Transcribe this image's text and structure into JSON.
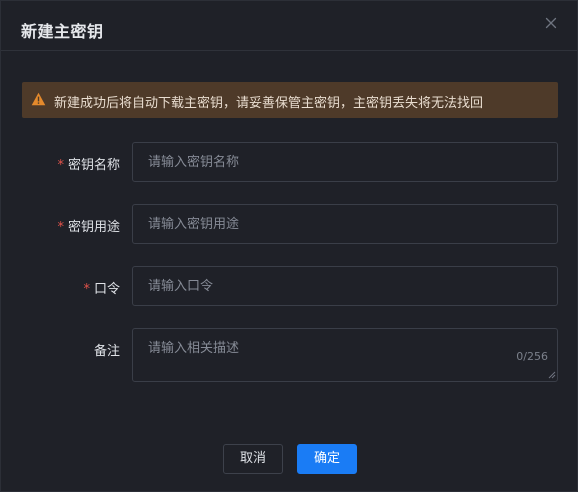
{
  "dialog": {
    "title": "新建主密钥"
  },
  "alert": {
    "text": "新建成功后将自动下载主密钥，请妥善保管主密钥，主密钥丢失将无法找回",
    "icon": "warning-icon",
    "color": "#e58a2c"
  },
  "form": {
    "key_name": {
      "label": "密钥名称",
      "required_mark": "*",
      "placeholder": "请输入密钥名称",
      "value": ""
    },
    "key_usage": {
      "label": "密钥用途",
      "required_mark": "*",
      "placeholder": "请输入密钥用途",
      "value": ""
    },
    "passphrase": {
      "label": "口令",
      "required_mark": "*",
      "placeholder": "请输入口令",
      "value": ""
    },
    "remark": {
      "label": "备注",
      "placeholder": "请输入相关描述",
      "value": "",
      "counter": "0/256"
    }
  },
  "footer": {
    "cancel_label": "取消",
    "confirm_label": "确定"
  },
  "colors": {
    "accent": "#1a7cf5",
    "required": "#e5534b",
    "alert_bg": "#4e3a29"
  }
}
